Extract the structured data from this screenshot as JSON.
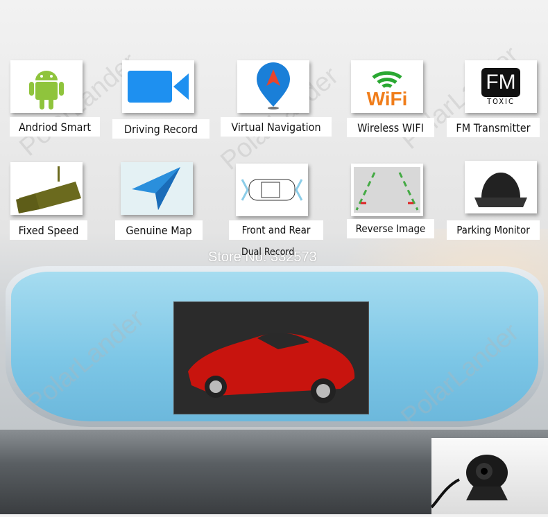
{
  "features": [
    {
      "label": "Andriod Smart",
      "icon": "android-icon"
    },
    {
      "label": "Driving Record",
      "icon": "video-camera-icon"
    },
    {
      "label": "Virtual Navigation",
      "icon": "map-pin-icon"
    },
    {
      "label": "Wireless WIFI",
      "icon": "wifi-icon"
    },
    {
      "label": "FM Transmitter",
      "icon": "fm-icon"
    },
    {
      "label": "Fixed Speed",
      "icon": "speed-camera-icon"
    },
    {
      "label": "Genuine Map",
      "icon": "paper-plane-icon"
    },
    {
      "label": "Front and Rear",
      "icon": "car-top-icon"
    },
    {
      "label": "Reverse Image",
      "icon": "parking-lines-icon"
    },
    {
      "label": "Parking Monitor",
      "icon": "dome-camera-icon"
    }
  ],
  "wifi_text": "WiFi",
  "fm_text": "FM",
  "fm_sub": "TOXIC",
  "dual_record": "Dual Record",
  "store": "Store No: 332573",
  "watermark": "PolarLander"
}
